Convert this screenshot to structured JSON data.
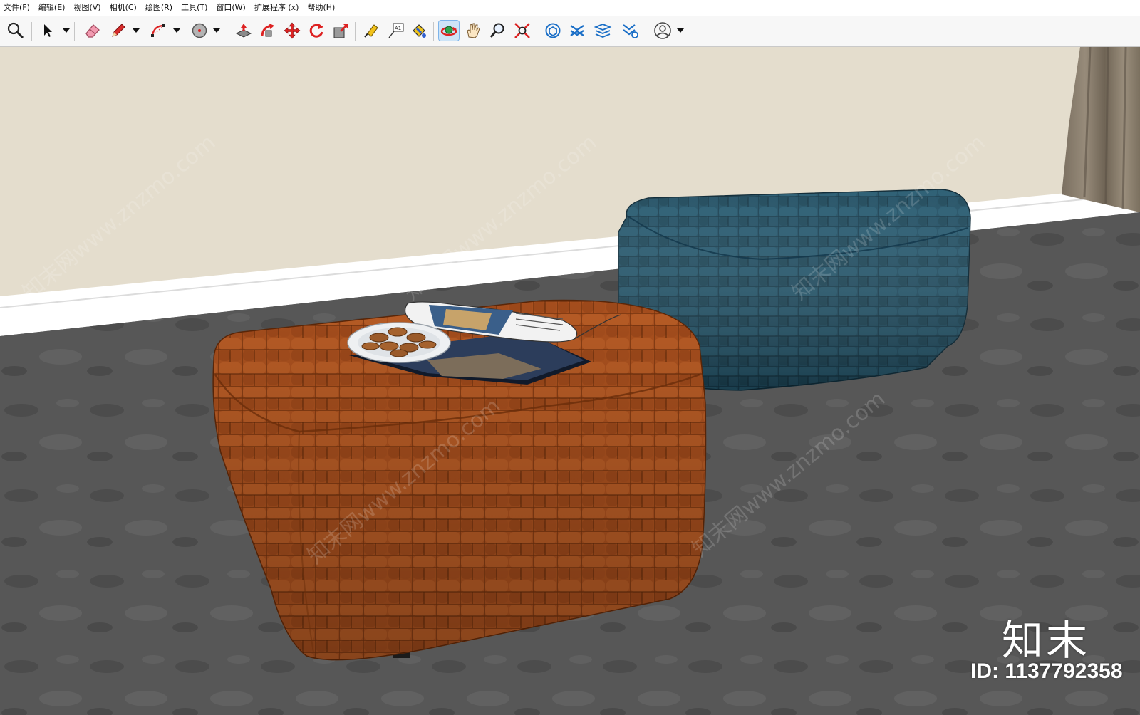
{
  "app": {
    "menus": [
      "文件(F)",
      "编辑(E)",
      "视图(V)",
      "相机(C)",
      "绘图(R)",
      "工具(T)",
      "窗口(W)",
      "扩展程序 (x)",
      "帮助(H)"
    ]
  },
  "toolbar": {
    "active_tool": "orbit",
    "tools": [
      "zoom-extents-search",
      "select",
      "eraser",
      "pencil-line",
      "arc",
      "circle-shape",
      "push-pull",
      "follow-me",
      "move",
      "rotate",
      "scale",
      "tape-measure",
      "text-label",
      "paint-bucket",
      "orbit",
      "pan-hand",
      "zoom",
      "zoom-extents",
      "3d-warehouse",
      "extension-warehouse",
      "layout",
      "extension-manager",
      "account"
    ]
  },
  "scene": {
    "wall_color": "#e4ddcd",
    "skirting_color": "#ffffff",
    "floor_color": "#575757",
    "curtain_color": "#8c8070",
    "ottoman_left_color": "#a9501e",
    "ottoman_right_color": "#1f4e63"
  },
  "watermark": {
    "text": "知末网www.znzmo.com",
    "logo": "知末",
    "id_label": "ID: 1137792358"
  }
}
